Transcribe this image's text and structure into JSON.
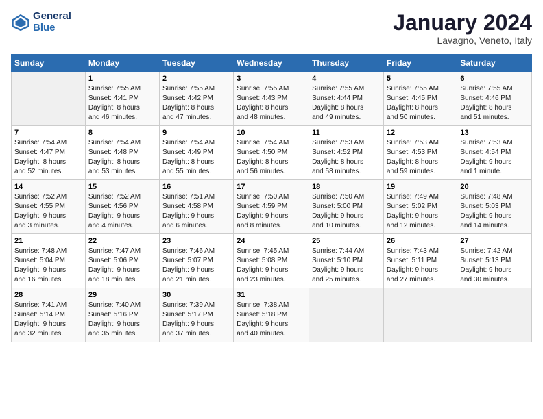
{
  "header": {
    "logo_line1": "General",
    "logo_line2": "Blue",
    "month_title": "January 2024",
    "location": "Lavagno, Veneto, Italy"
  },
  "days_of_week": [
    "Sunday",
    "Monday",
    "Tuesday",
    "Wednesday",
    "Thursday",
    "Friday",
    "Saturday"
  ],
  "weeks": [
    [
      {
        "date": "",
        "info": ""
      },
      {
        "date": "1",
        "info": "Sunrise: 7:55 AM\nSunset: 4:41 PM\nDaylight: 8 hours\nand 46 minutes."
      },
      {
        "date": "2",
        "info": "Sunrise: 7:55 AM\nSunset: 4:42 PM\nDaylight: 8 hours\nand 47 minutes."
      },
      {
        "date": "3",
        "info": "Sunrise: 7:55 AM\nSunset: 4:43 PM\nDaylight: 8 hours\nand 48 minutes."
      },
      {
        "date": "4",
        "info": "Sunrise: 7:55 AM\nSunset: 4:44 PM\nDaylight: 8 hours\nand 49 minutes."
      },
      {
        "date": "5",
        "info": "Sunrise: 7:55 AM\nSunset: 4:45 PM\nDaylight: 8 hours\nand 50 minutes."
      },
      {
        "date": "6",
        "info": "Sunrise: 7:55 AM\nSunset: 4:46 PM\nDaylight: 8 hours\nand 51 minutes."
      }
    ],
    [
      {
        "date": "7",
        "info": "Sunrise: 7:54 AM\nSunset: 4:47 PM\nDaylight: 8 hours\nand 52 minutes."
      },
      {
        "date": "8",
        "info": "Sunrise: 7:54 AM\nSunset: 4:48 PM\nDaylight: 8 hours\nand 53 minutes."
      },
      {
        "date": "9",
        "info": "Sunrise: 7:54 AM\nSunset: 4:49 PM\nDaylight: 8 hours\nand 55 minutes."
      },
      {
        "date": "10",
        "info": "Sunrise: 7:54 AM\nSunset: 4:50 PM\nDaylight: 8 hours\nand 56 minutes."
      },
      {
        "date": "11",
        "info": "Sunrise: 7:53 AM\nSunset: 4:52 PM\nDaylight: 8 hours\nand 58 minutes."
      },
      {
        "date": "12",
        "info": "Sunrise: 7:53 AM\nSunset: 4:53 PM\nDaylight: 8 hours\nand 59 minutes."
      },
      {
        "date": "13",
        "info": "Sunrise: 7:53 AM\nSunset: 4:54 PM\nDaylight: 9 hours\nand 1 minute."
      }
    ],
    [
      {
        "date": "14",
        "info": "Sunrise: 7:52 AM\nSunset: 4:55 PM\nDaylight: 9 hours\nand 3 minutes."
      },
      {
        "date": "15",
        "info": "Sunrise: 7:52 AM\nSunset: 4:56 PM\nDaylight: 9 hours\nand 4 minutes."
      },
      {
        "date": "16",
        "info": "Sunrise: 7:51 AM\nSunset: 4:58 PM\nDaylight: 9 hours\nand 6 minutes."
      },
      {
        "date": "17",
        "info": "Sunrise: 7:50 AM\nSunset: 4:59 PM\nDaylight: 9 hours\nand 8 minutes."
      },
      {
        "date": "18",
        "info": "Sunrise: 7:50 AM\nSunset: 5:00 PM\nDaylight: 9 hours\nand 10 minutes."
      },
      {
        "date": "19",
        "info": "Sunrise: 7:49 AM\nSunset: 5:02 PM\nDaylight: 9 hours\nand 12 minutes."
      },
      {
        "date": "20",
        "info": "Sunrise: 7:48 AM\nSunset: 5:03 PM\nDaylight: 9 hours\nand 14 minutes."
      }
    ],
    [
      {
        "date": "21",
        "info": "Sunrise: 7:48 AM\nSunset: 5:04 PM\nDaylight: 9 hours\nand 16 minutes."
      },
      {
        "date": "22",
        "info": "Sunrise: 7:47 AM\nSunset: 5:06 PM\nDaylight: 9 hours\nand 18 minutes."
      },
      {
        "date": "23",
        "info": "Sunrise: 7:46 AM\nSunset: 5:07 PM\nDaylight: 9 hours\nand 21 minutes."
      },
      {
        "date": "24",
        "info": "Sunrise: 7:45 AM\nSunset: 5:08 PM\nDaylight: 9 hours\nand 23 minutes."
      },
      {
        "date": "25",
        "info": "Sunrise: 7:44 AM\nSunset: 5:10 PM\nDaylight: 9 hours\nand 25 minutes."
      },
      {
        "date": "26",
        "info": "Sunrise: 7:43 AM\nSunset: 5:11 PM\nDaylight: 9 hours\nand 27 minutes."
      },
      {
        "date": "27",
        "info": "Sunrise: 7:42 AM\nSunset: 5:13 PM\nDaylight: 9 hours\nand 30 minutes."
      }
    ],
    [
      {
        "date": "28",
        "info": "Sunrise: 7:41 AM\nSunset: 5:14 PM\nDaylight: 9 hours\nand 32 minutes."
      },
      {
        "date": "29",
        "info": "Sunrise: 7:40 AM\nSunset: 5:16 PM\nDaylight: 9 hours\nand 35 minutes."
      },
      {
        "date": "30",
        "info": "Sunrise: 7:39 AM\nSunset: 5:17 PM\nDaylight: 9 hours\nand 37 minutes."
      },
      {
        "date": "31",
        "info": "Sunrise: 7:38 AM\nSunset: 5:18 PM\nDaylight: 9 hours\nand 40 minutes."
      },
      {
        "date": "",
        "info": ""
      },
      {
        "date": "",
        "info": ""
      },
      {
        "date": "",
        "info": ""
      }
    ]
  ]
}
